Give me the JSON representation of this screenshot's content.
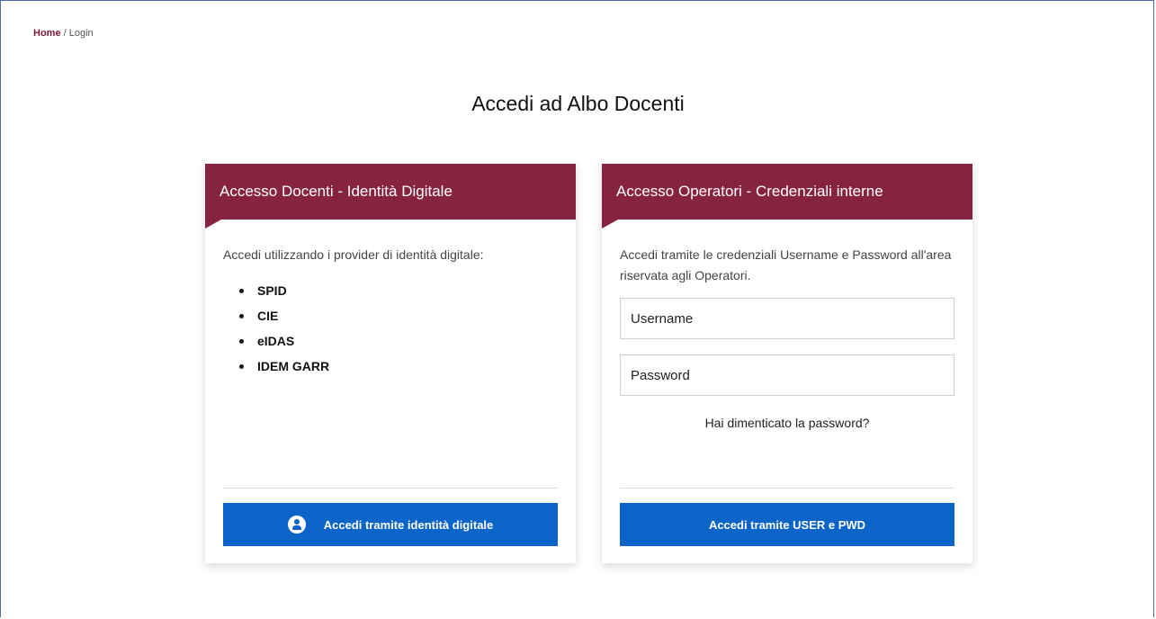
{
  "breadcrumb": {
    "home": "Home",
    "separator": " / ",
    "current": "Login"
  },
  "page_title": "Accedi ad Albo Docenti",
  "left_card": {
    "title": "Accesso Docenti - Identità Digitale",
    "intro": "Accedi utilizzando i provider di identità digitale:",
    "providers": [
      "SPID",
      "CIE",
      "eIDAS",
      "IDEM GARR"
    ],
    "button_label": "Accedi tramite identità digitale",
    "button_icon": "user-circle-icon"
  },
  "right_card": {
    "title": "Accesso Operatori - Credenziali interne",
    "intro": "Accedi tramite le credenziali Username e Password all'area riservata agli Operatori.",
    "username_placeholder": "Username",
    "password_placeholder": "Password",
    "forgot_link": "Hai dimenticato la password?",
    "button_label": "Accedi tramite USER e PWD"
  },
  "colors": {
    "header_bg": "#862340",
    "button_bg": "#0b64c7",
    "breadcrumb_link": "#7b1d36"
  }
}
